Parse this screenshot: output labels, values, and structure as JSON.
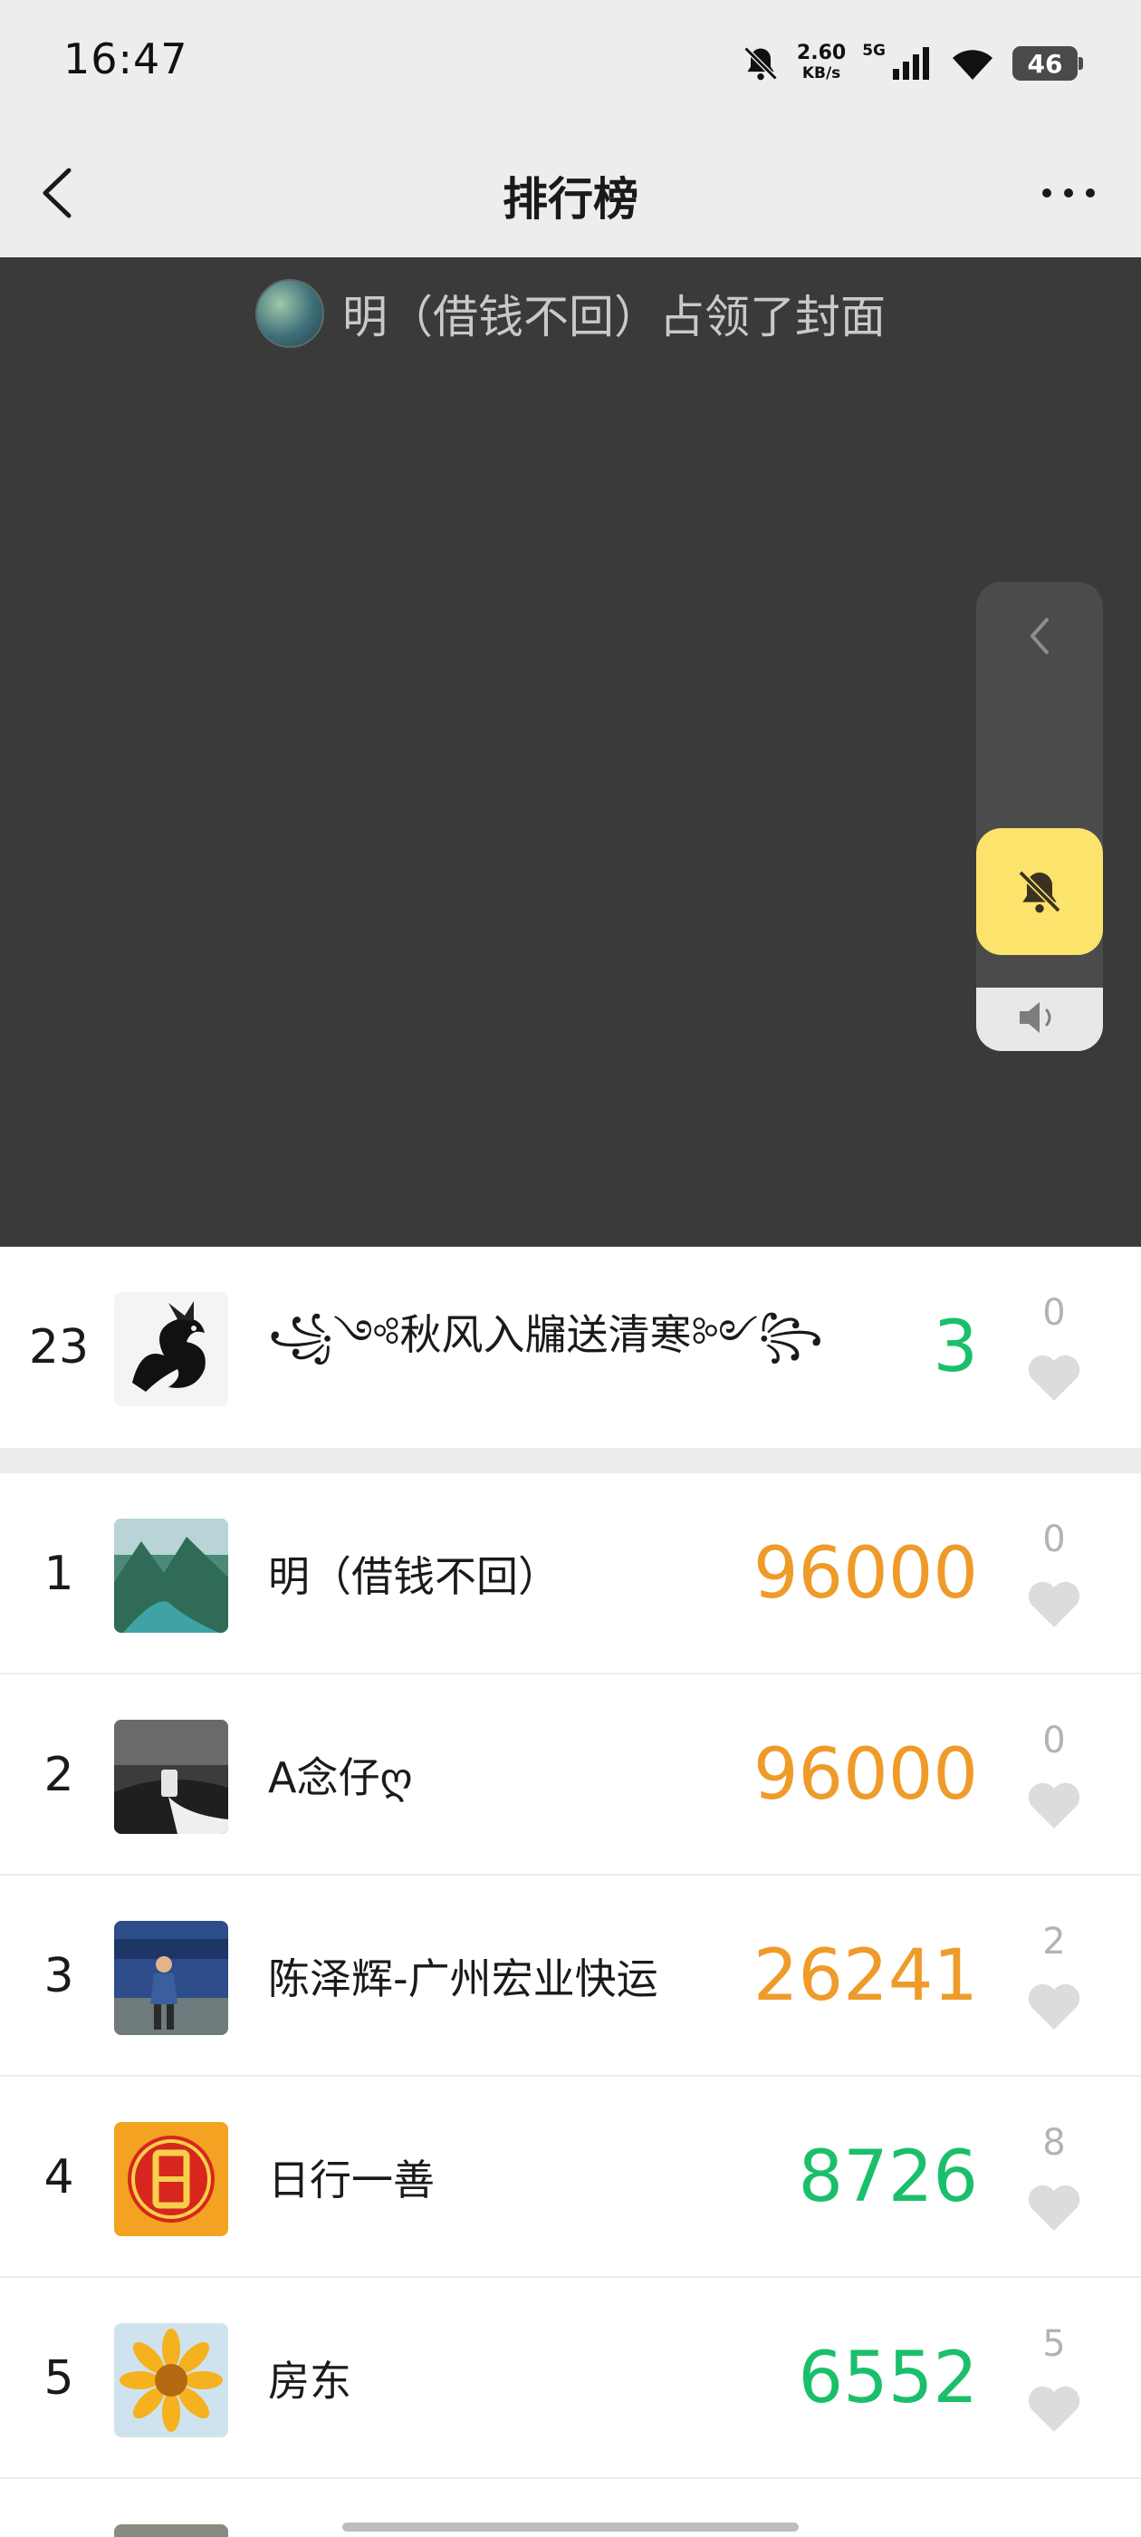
{
  "status_bar": {
    "time": "16:47",
    "speed_value": "2.60",
    "speed_unit": "KB/s",
    "network": "5G",
    "battery": "46",
    "icons": [
      "bell-mute-icon",
      "signal-icon",
      "wifi-icon",
      "battery-icon"
    ]
  },
  "nav": {
    "title": "排行榜",
    "icons": [
      "back-chevron-icon",
      "more-dots-icon"
    ]
  },
  "cover": {
    "banner_text": "明（借钱不回）占领了封面",
    "icons": [
      "collapse-chevron-icon",
      "volume-icon",
      "bell-off-icon"
    ]
  },
  "my_rank": {
    "rank": "23",
    "name": "꧁༺秋风入牖送清寒༻꧂",
    "steps": "3",
    "likes": "0"
  },
  "ranking": [
    {
      "rank": "1",
      "name": "明（借钱不回）",
      "steps": "96000",
      "likes": "0"
    },
    {
      "rank": "2",
      "name": "A念仔ღ",
      "steps": "96000",
      "likes": "0"
    },
    {
      "rank": "3",
      "name": "陈泽辉-广州宏业快运",
      "steps": "26241",
      "likes": "2"
    },
    {
      "rank": "4",
      "name": "日行一善",
      "steps": "8726",
      "likes": "8"
    },
    {
      "rank": "5",
      "name": "房东",
      "steps": "6552",
      "likes": "5"
    }
  ],
  "colors": {
    "high_steps": "#ef9b2a",
    "low_steps": "#1bbf6b",
    "mute_button": "#fbe36c",
    "cover_bg": "#3a3a3a"
  }
}
